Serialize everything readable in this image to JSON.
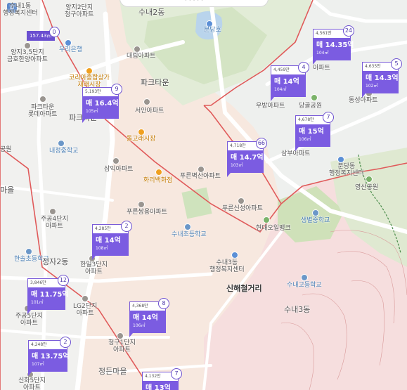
{
  "top_bar_text": "· · ·  ·  ·",
  "labels": {
    "suinae1": "수내1동\n행정복지센터",
    "yangji2": "양지2단지\n청구아파트",
    "suinae2": "수내2동",
    "yangji35": "양지3,5단지\n금호한양아파트",
    "urieun": "우리은행",
    "daerim": "대림아파트",
    "park_town": "파크타운",
    "coriabank": "코리아종합상가\n재래시장",
    "hapheung": "파크타운\n롯데아파트",
    "parktown_s": "파크타운",
    "seoan": "서안아파트",
    "bundangho": "분당호",
    "sinsejogeori": "신해철거리",
    "naejeong": "내정중학교",
    "dolgoregi": "돌고래시장",
    "samik": "삼익아파트",
    "hwarimarket": "화리백화점",
    "pureunbyuksan": "푸른벽산아파트",
    "pureunssangyong": "푸른쌍용아파트",
    "pureunsinseong": "푸른신성아파트",
    "suinae_es": "수내초등학교",
    "hyundai_oil": "현대오일뱅크",
    "saengmyung": "생별중학교",
    "suinae3_office": "수내3동\n행정복지센터",
    "suinae_hs": "수내고등학교",
    "suinae3": "수내3동",
    "ju24": "주공4단지\n아파트",
    "hansol": "한솔초등학교",
    "jeongja2": "정자2동",
    "hanil": "한일3단지\n아파트",
    "ju5": "주공5단지\n아파트",
    "lg2": "LG2단지\n아파트",
    "chunggu1": "청구1단지\n아파트",
    "jeongdeun": "정든마을",
    "sinhwa5": "신화5단지\n아파트",
    "geumgok": "마을",
    "gongwon": "공원",
    "ubang": "우방아파트",
    "dangdang": "당골공원",
    "dongsung": "동성아파트",
    "sambu": "삼부아파트",
    "bundangdong": "분당동\n행정복지센터",
    "yeongsan": "영산공원",
    "apt_9a": "아파트"
  },
  "markers": [
    {
      "top": "5,193만",
      "count": "9",
      "price": "매 16.4억",
      "area": "105㎡"
    },
    {
      "top": "4,718만",
      "count": "66",
      "price": "매 14.7억",
      "area": "103㎡"
    },
    {
      "top": "4,561만",
      "count": "24",
      "price": "매 14.35억",
      "area": "104㎡"
    },
    {
      "top": "4,459만",
      "count": "4",
      "price": "매 14억",
      "area": "104㎡"
    },
    {
      "top": "4,635만",
      "count": "5",
      "price": "매 14.3억",
      "area": "102㎡"
    },
    {
      "top": "4,678만",
      "count": "7",
      "price": "매 15억",
      "area": "106㎡"
    },
    {
      "top": "4,285만",
      "count": "2",
      "price": "매 14억",
      "area": "108㎡"
    },
    {
      "top": "3,846만",
      "count": "12",
      "price": "매 11.75억",
      "area": "101㎡"
    },
    {
      "top": "4,368만",
      "count": "8",
      "price": "매 14억",
      "area": "106㎡"
    },
    {
      "top": "4,248만",
      "count": "2",
      "price": "매 13.75억",
      "area": "107㎡"
    },
    {
      "top": "4,132만",
      "count": "7",
      "price": "매 13억",
      "area": ""
    }
  ],
  "chip": {
    "label": "157.43㎡",
    "count": "0"
  },
  "colors": {
    "marker_fill": "#7b5ce1",
    "district_border": "#e05a5a",
    "park": "#d8e8c8",
    "water": "#b9d4ec"
  }
}
